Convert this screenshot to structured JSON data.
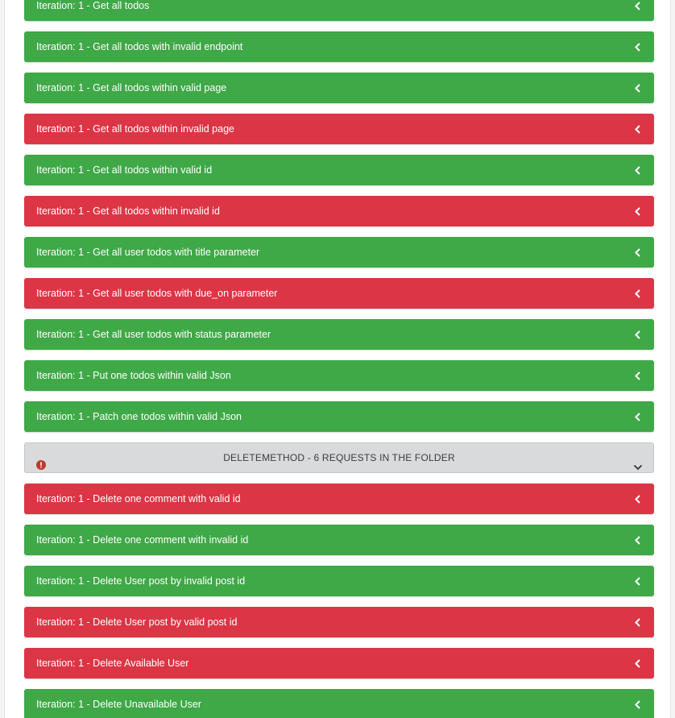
{
  "rows_top": [
    {
      "label": "Iteration: 1 - Get all todos",
      "status": "pass"
    },
    {
      "label": "Iteration: 1 - Get all todos with invalid endpoint",
      "status": "pass"
    },
    {
      "label": "Iteration: 1 - Get all todos within valid page",
      "status": "pass"
    },
    {
      "label": "Iteration: 1 - Get all todos within invalid page",
      "status": "fail"
    },
    {
      "label": "Iteration: 1 - Get all todos within valid id",
      "status": "pass"
    },
    {
      "label": "Iteration: 1 - Get all todos within invalid id",
      "status": "fail"
    },
    {
      "label": "Iteration: 1 - Get all user todos with title parameter",
      "status": "pass"
    },
    {
      "label": "Iteration: 1 - Get all user todos with due_on parameter",
      "status": "fail"
    },
    {
      "label": "Iteration: 1 - Get all user todos with status parameter",
      "status": "pass"
    },
    {
      "label": "Iteration: 1 - Put one todos within valid Json",
      "status": "pass"
    },
    {
      "label": "Iteration: 1 - Patch one todos within valid Json",
      "status": "pass"
    }
  ],
  "folder": {
    "label": "DELETEMETHOD - 6 REQUESTS IN THE FOLDER",
    "icon": "info-circle-icon",
    "icon_color": "#c0392b"
  },
  "rows_bottom": [
    {
      "label": "Iteration: 1 - Delete one comment with valid id",
      "status": "fail"
    },
    {
      "label": "Iteration: 1 - Delete one comment with invalid id",
      "status": "pass"
    },
    {
      "label": "Iteration: 1 - Delete User post by invalid post id",
      "status": "pass"
    },
    {
      "label": "Iteration: 1 - Delete User post by valid post id",
      "status": "fail"
    },
    {
      "label": "Iteration: 1 - Delete Available User",
      "status": "fail"
    },
    {
      "label": "Iteration: 1 - Delete Unavailable User",
      "status": "pass"
    }
  ],
  "colors": {
    "pass": "#3fa847",
    "fail": "#dc3545",
    "folder_bg": "#d9dadc"
  }
}
